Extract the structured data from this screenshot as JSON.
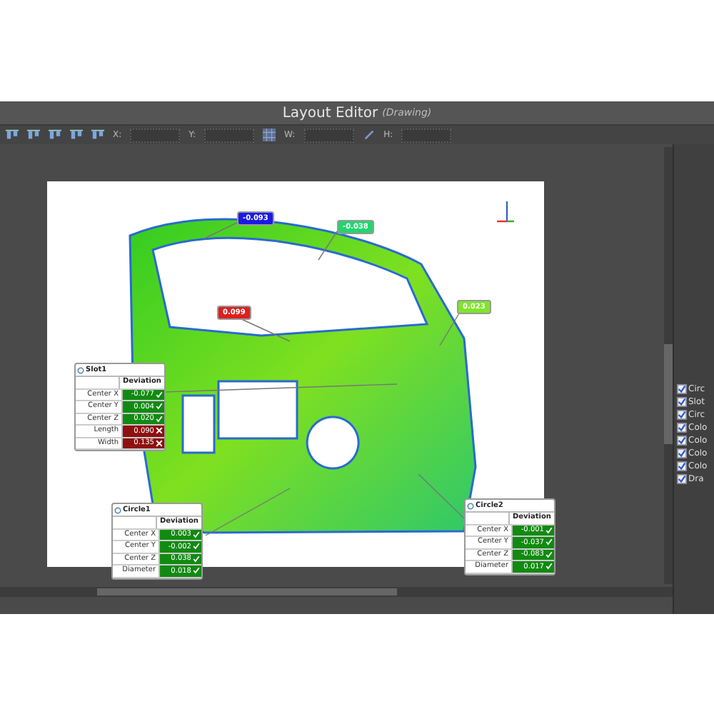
{
  "window": {
    "title": "Layout Editor",
    "subtitle": "(Drawing)"
  },
  "toolbar": {
    "fields": [
      {
        "label": "X:"
      },
      {
        "label": "Y:"
      },
      {
        "label": "W:"
      },
      {
        "label": "H:"
      }
    ]
  },
  "flags": [
    {
      "value": "-0.093",
      "color": "#1a1ae6"
    },
    {
      "value": "-0.038",
      "color": "#22d66e"
    },
    {
      "value": "0.099",
      "color": "#dd1f1f"
    },
    {
      "value": "0.023",
      "color": "#7ee62a"
    }
  ],
  "tables": [
    {
      "title": "Slot1",
      "header": "Deviation",
      "rows": [
        {
          "label": "Center X",
          "value": "-0.077",
          "passed": true
        },
        {
          "label": "Center Y",
          "value": "0.004",
          "passed": true
        },
        {
          "label": "Center Z",
          "value": "0.020",
          "passed": true
        },
        {
          "label": "Length",
          "value": "0.090",
          "passed": false
        },
        {
          "label": "Width",
          "value": "0.135",
          "passed": false
        }
      ]
    },
    {
      "title": "Circle1",
      "header": "Deviation",
      "rows": [
        {
          "label": "Center X",
          "value": "0.003",
          "passed": true
        },
        {
          "label": "Center Y",
          "value": "-0.002",
          "passed": true
        },
        {
          "label": "Center Z",
          "value": "0.038",
          "passed": true
        },
        {
          "label": "Diameter",
          "value": "0.018",
          "passed": true
        }
      ]
    },
    {
      "title": "Circle2",
      "header": "Deviation",
      "rows": [
        {
          "label": "Center X",
          "value": "-0.001",
          "passed": true
        },
        {
          "label": "Center Y",
          "value": "-0.037",
          "passed": true
        },
        {
          "label": "Center Z",
          "value": "-0.083",
          "passed": true
        },
        {
          "label": "Diameter",
          "value": "0.017",
          "passed": true
        }
      ]
    }
  ],
  "side_panel": {
    "items": [
      {
        "label": "Circ",
        "checked": true
      },
      {
        "label": "Slot",
        "checked": true
      },
      {
        "label": "Circ",
        "checked": true
      },
      {
        "label": "Colo",
        "checked": true
      },
      {
        "label": "Colo",
        "checked": true
      },
      {
        "label": "Colo",
        "checked": true
      },
      {
        "label": "Colo",
        "checked": true
      },
      {
        "label": "Dra",
        "checked": true
      }
    ]
  }
}
